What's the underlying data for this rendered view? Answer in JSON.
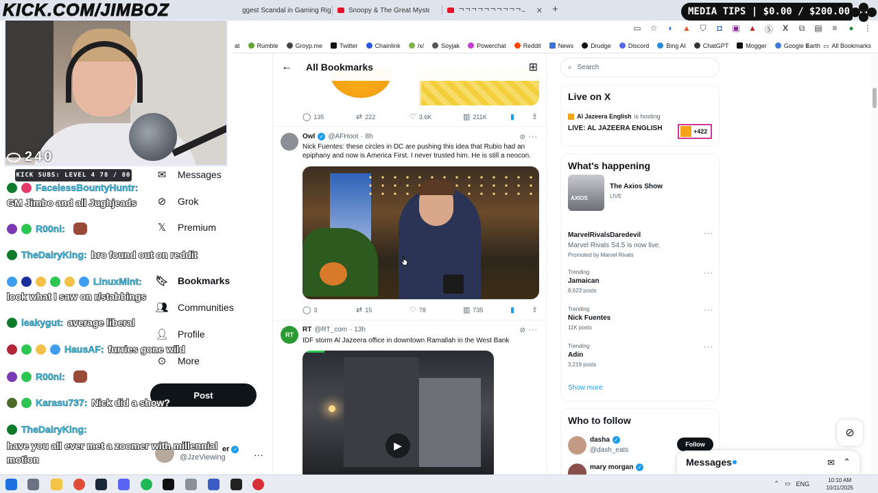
{
  "stream": {
    "channel_logo": "KICK.COM/JIMBOZ",
    "viewer_count": "240",
    "subs_bar": "KICK SUBS: LEVEL 4 78 / 80",
    "media_tips": "MEDIA TIPS | $0.00 / $200.00"
  },
  "browser": {
    "tabs": [
      {
        "label": "ggest Scandal in Gaming Rig"
      },
      {
        "label": "Snoopy & The Great Mystery C"
      },
      {
        "label": "ᄀᄀᄀᄀᄀᄀᄀᄀᄀᄀ~"
      }
    ],
    "bookmarks": [
      "at",
      "Rumble",
      "Groyp.me",
      "Twitter",
      "Chainlink",
      "/x/",
      "Soyjak",
      "Powerchat",
      "Reddit",
      "News",
      "Drudge",
      "Discord",
      "Bing AI",
      "ChatGPT",
      "Mogger",
      "Google Earth"
    ],
    "all_bookmarks": "All Bookmarks"
  },
  "chat": [
    {
      "user": "FacelessBountyHuntr:",
      "msg": "GM Jimbo and all Jughjeads",
      "badges": [
        "#0f7a2b",
        "#e23b6b"
      ]
    },
    {
      "user": "R00ni:",
      "msg": "",
      "badges": [
        "#7a3ab3",
        "#2dc653"
      ]
    },
    {
      "user": "TheDairyKing:",
      "msg": "bro found out on reddit",
      "badges": [
        "#0f7a2b"
      ]
    },
    {
      "user": "LinuxMint:",
      "msg": "look what I saw on r/stabbings",
      "badges": [
        "#3f9df0",
        "#1a2f9e",
        "#f3c14a",
        "#2dc653",
        "#f3c14a",
        "#3f9df0"
      ]
    },
    {
      "user": "leakygut:",
      "msg": "average liberal",
      "badges": [
        "#0f7a2b"
      ]
    },
    {
      "user": "HausAF:",
      "msg": "furries gone wild",
      "badges": [
        "#b3263a",
        "#2dc653",
        "#f3c14a",
        "#3f9df0"
      ]
    },
    {
      "user": "R00ni:",
      "msg": "",
      "badges": [
        "#7a3ab3",
        "#2dc653"
      ]
    },
    {
      "user": "Karasu737:",
      "msg": "Nick did a show?",
      "badges": [
        "#4a6a2a",
        "#2dc653"
      ]
    },
    {
      "user": "TheDairyKing:",
      "msg": "have you all ever met a zoomer with millennial motion",
      "badges": [
        "#0f7a2b"
      ]
    }
  ],
  "sidebar": {
    "items": [
      {
        "label": "Messages",
        "icon": "envelope-icon"
      },
      {
        "label": "Grok",
        "icon": "grok-icon"
      },
      {
        "label": "Premium",
        "icon": "x-logo-icon"
      },
      {
        "label": "Bookmarks",
        "icon": "bookmark-icon"
      },
      {
        "label": "Communities",
        "icon": "people-icon"
      },
      {
        "label": "Profile",
        "icon": "person-icon"
      },
      {
        "label": "More",
        "icon": "more-circle-icon"
      }
    ],
    "post_label": "Post",
    "account": {
      "name": "er",
      "handle": "@JzeViewing"
    }
  },
  "feed": {
    "title": "All Bookmarks",
    "tweet0": {
      "replies": "135",
      "reposts": "222",
      "likes": "3.6K",
      "views": "211K"
    },
    "tweet1": {
      "name": "Owl",
      "handle": "@AFHoot",
      "time": "· 8h",
      "text": "Nick Fuentes: these circles in DC are pushing this idea that Rubio had an epiphany and now is America First. I never trusted him. He is still a neocon.",
      "replies": "3",
      "reposts": "15",
      "likes": "78",
      "views": "735"
    },
    "tweet2": {
      "name": "RT",
      "handle": "@RT_com",
      "time": "· 13h",
      "avatar_text": "RT",
      "text": "IDF storm Al Jazeera office in downtown Ramallah in the West Bank"
    }
  },
  "right": {
    "search_placeholder": "Search",
    "live": {
      "title": "Live on X",
      "host": "Al Jazeera English",
      "host_suffix": "is hosting",
      "show": "LIVE: AL JAZEERA ENGLISH",
      "count": "+422"
    },
    "happening": {
      "title": "What's happening",
      "featured": {
        "name": "The Axios Show",
        "sub": "LIVE",
        "thumb_text": "AXIOS"
      },
      "items": [
        {
          "label": "",
          "name": "MarvelRivalsDaredevil",
          "desc": "Marvel Rivals S4.5 is now live.",
          "sub": "Promoted by Marvel Rivals"
        },
        {
          "label": "Trending",
          "name": "Jamaican",
          "desc": "",
          "sub": "8,623 posts"
        },
        {
          "label": "Trending",
          "name": "Nick Fuentes",
          "desc": "",
          "sub": "11K posts"
        },
        {
          "label": "Trending",
          "name": "Adin",
          "desc": "",
          "sub": "3,219 posts"
        }
      ],
      "show_more": "Show more"
    },
    "who_to_follow": {
      "title": "Who to follow",
      "accounts": [
        {
          "name": "dasha",
          "handle": "@dash_eats",
          "button": "Follow"
        },
        {
          "name": "mary morgan",
          "handle": "",
          "button": ""
        }
      ]
    },
    "messages_drawer": "Messages"
  },
  "taskbar": {
    "lang": "ENG",
    "time": "10:10 AM",
    "date": "10/11/2025"
  }
}
